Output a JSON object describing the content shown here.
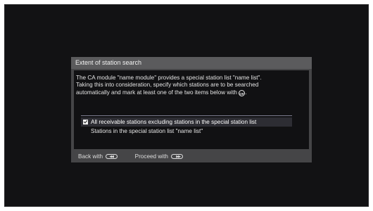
{
  "dialog": {
    "title": "Extent of station search",
    "desc_line1": "The CA module \"name module\" provides a special station list \"name list\".",
    "desc_line2": "Taking this into consideration, specify which stations are to be searched",
    "desc_line3": "automatically and mark at least one of the two items below with",
    "desc_line3_end": ".",
    "ok_icon_glyph": "OK",
    "options": [
      {
        "label": "All receivable stations excluding stations in the special station list",
        "checked": true
      },
      {
        "label": "Stations in the special station list \"name list\"",
        "checked": false
      }
    ]
  },
  "footer": {
    "back_label": "Back with",
    "proceed_label": "Proceed with",
    "back_icon": "rewind-button-icon",
    "proceed_icon": "fast-forward-button-icon"
  },
  "colors": {
    "screen": "#121214",
    "dialog": "#454547",
    "title_bar": "#5b5b5d",
    "selected_row": "#2d2d33"
  }
}
